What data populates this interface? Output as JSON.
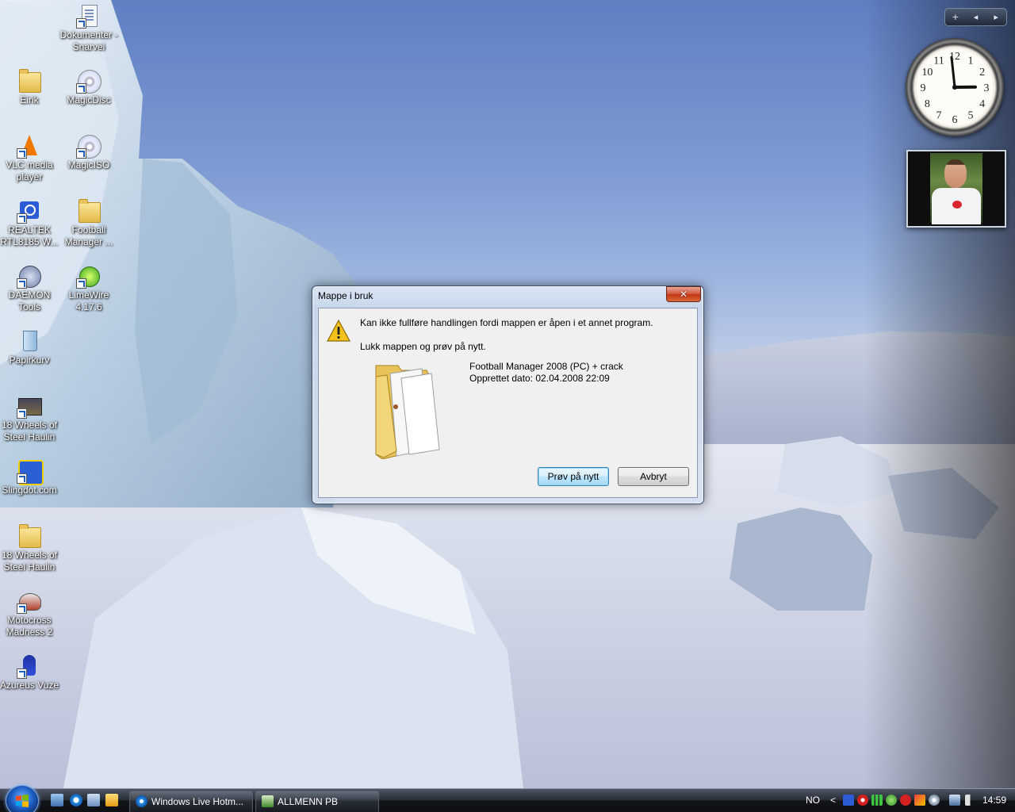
{
  "desktop": {
    "icons": [
      {
        "label": "Dokumenter - Snarvei",
        "icon": "document-shortcut-icon"
      },
      {
        "label": "Eirik",
        "icon": "folder-icon"
      },
      {
        "label": "MagicDisc",
        "icon": "magicdisc-icon"
      },
      {
        "label": "VLC media player",
        "icon": "vlc-icon"
      },
      {
        "label": "MagicISO",
        "icon": "magiciso-icon"
      },
      {
        "label": "REALTEK RTL8185 W...",
        "icon": "network-adapter-icon"
      },
      {
        "label": "Football Manager ...",
        "icon": "folder-icon"
      },
      {
        "label": "DAEMON Tools",
        "icon": "daemon-tools-icon"
      },
      {
        "label": "LimeWire 4.17.6",
        "icon": "limewire-icon"
      },
      {
        "label": "Papirkurv",
        "icon": "recycle-bin-icon"
      },
      {
        "label": "18 Wheels of Steel Haulin",
        "icon": "truck-game-icon"
      },
      {
        "label": "Slingdot.com",
        "icon": "slingdot-icon"
      },
      {
        "label": "18 Wheels of Steel Haulin",
        "icon": "folder-icon"
      },
      {
        "label": "Motocross Madness 2",
        "icon": "motocross-icon"
      },
      {
        "label": "Azureus Vuze",
        "icon": "azureus-icon"
      }
    ]
  },
  "gadgets": {
    "toolbar": {
      "add": "+",
      "prev": "◂",
      "next": "▸"
    },
    "clock": {
      "numbers": [
        "12",
        "1",
        "2",
        "3",
        "4",
        "5",
        "6",
        "7",
        "8",
        "9",
        "10",
        "11"
      ],
      "hour": 2,
      "minute": 59
    },
    "slideshow": {
      "subject": "football-player-photo"
    }
  },
  "dialog": {
    "title": "Mappe i bruk",
    "close_label": "✕",
    "message": "Kan ikke fullføre handlingen fordi mappen er åpen i et annet program.",
    "instruction": "Lukk mappen og prøv på nytt.",
    "item_name": "Football Manager 2008 (PC) + crack",
    "item_date": "Opprettet dato: 02.04.2008 22:09",
    "retry_button": "Prøv på nytt",
    "cancel_button": "Avbryt"
  },
  "taskbar": {
    "quick_launch": [
      "show-desktop-icon",
      "internet-explorer-icon",
      "switch-windows-icon",
      "media-player-icon"
    ],
    "tasks": [
      {
        "label": "Windows Live Hotm...",
        "icon": "internet-explorer-icon"
      },
      {
        "label": "ALLMENN PB",
        "icon": "excel-icon"
      }
    ],
    "language": "NO",
    "tray_chevron": "<",
    "clock": "14:59"
  },
  "colors": {
    "sky": "#7f9bd3",
    "ice": "#cfe0ee",
    "dialog_frame": "#cddaee",
    "close_red": "#c8401a",
    "default_button": "#bee6fd",
    "taskbar": "#1a1e25"
  }
}
